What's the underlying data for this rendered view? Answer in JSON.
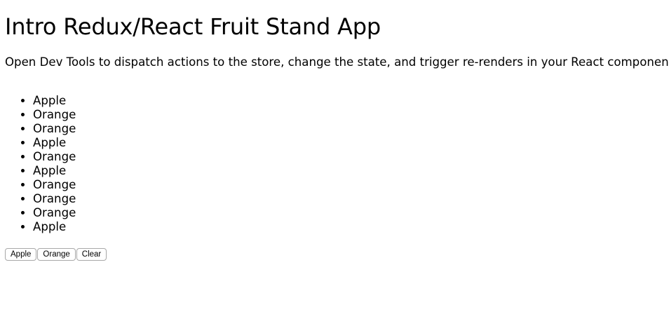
{
  "page": {
    "title": "Intro Redux/React Fruit Stand App",
    "subtitle": "Open Dev Tools to dispatch actions to the store, change the state, and trigger re-renders in your React component!"
  },
  "fruit_list": [
    "Apple",
    "Orange",
    "Orange",
    "Apple",
    "Orange",
    "Apple",
    "Orange",
    "Orange",
    "Orange",
    "Apple"
  ],
  "buttons": {
    "apple_label": "Apple",
    "orange_label": "Orange",
    "clear_label": "Clear"
  }
}
